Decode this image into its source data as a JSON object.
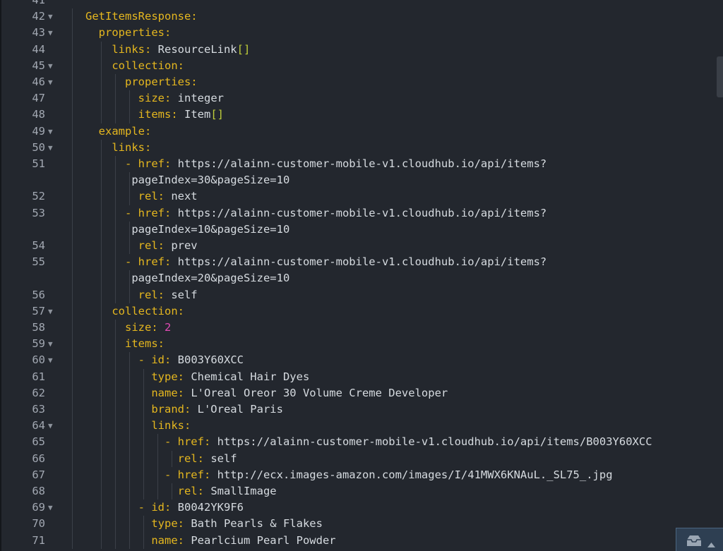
{
  "editor": {
    "colors": {
      "background": "#23272e",
      "key": "#e5b71f",
      "punct": "#c0ce3a",
      "number": "#e14bb4",
      "text": "#d6dbe0"
    },
    "lines": [
      {
        "num": "41",
        "fold": false,
        "segs": []
      },
      {
        "num": "42",
        "fold": true,
        "segs": [
          {
            "t": "GetItemsResponse:",
            "c": "k"
          }
        ]
      },
      {
        "num": "43",
        "fold": true,
        "segs": [
          {
            "t": "  properties:",
            "c": "k"
          }
        ]
      },
      {
        "num": "44",
        "fold": false,
        "segs": [
          {
            "t": "    links:",
            "c": "k"
          },
          {
            "t": " ResourceLink",
            "c": "v"
          },
          {
            "t": "[]",
            "c": "p"
          }
        ]
      },
      {
        "num": "45",
        "fold": true,
        "segs": [
          {
            "t": "    collection:",
            "c": "k"
          }
        ]
      },
      {
        "num": "46",
        "fold": true,
        "segs": [
          {
            "t": "      properties:",
            "c": "k"
          }
        ]
      },
      {
        "num": "47",
        "fold": false,
        "segs": [
          {
            "t": "        size:",
            "c": "k"
          },
          {
            "t": " integer",
            "c": "v"
          }
        ]
      },
      {
        "num": "48",
        "fold": false,
        "segs": [
          {
            "t": "        items:",
            "c": "k"
          },
          {
            "t": " Item",
            "c": "v"
          },
          {
            "t": "[]",
            "c": "p"
          }
        ]
      },
      {
        "num": "49",
        "fold": true,
        "segs": [
          {
            "t": "  example:",
            "c": "k"
          }
        ]
      },
      {
        "num": "50",
        "fold": true,
        "segs": [
          {
            "t": "    links:",
            "c": "k"
          }
        ]
      },
      {
        "num": "51",
        "fold": false,
        "segs": [
          {
            "t": "      - href:",
            "c": "k"
          },
          {
            "t": " https://alainn-customer-mobile-v1.cloudhub.io/api/items?",
            "c": "v"
          }
        ]
      },
      {
        "num": "",
        "fold": false,
        "segs": [
          {
            "t": "       pageIndex=30&pageSize=10",
            "c": "v"
          }
        ]
      },
      {
        "num": "52",
        "fold": false,
        "segs": [
          {
            "t": "        rel:",
            "c": "k"
          },
          {
            "t": " next",
            "c": "v"
          }
        ]
      },
      {
        "num": "53",
        "fold": false,
        "segs": [
          {
            "t": "      - href:",
            "c": "k"
          },
          {
            "t": " https://alainn-customer-mobile-v1.cloudhub.io/api/items?",
            "c": "v"
          }
        ]
      },
      {
        "num": "",
        "fold": false,
        "segs": [
          {
            "t": "       pageIndex=10&pageSize=10",
            "c": "v"
          }
        ]
      },
      {
        "num": "54",
        "fold": false,
        "segs": [
          {
            "t": "        rel:",
            "c": "k"
          },
          {
            "t": " prev",
            "c": "v"
          }
        ]
      },
      {
        "num": "55",
        "fold": false,
        "segs": [
          {
            "t": "      - href:",
            "c": "k"
          },
          {
            "t": " https://alainn-customer-mobile-v1.cloudhub.io/api/items?",
            "c": "v"
          }
        ]
      },
      {
        "num": "",
        "fold": false,
        "segs": [
          {
            "t": "       pageIndex=20&pageSize=10",
            "c": "v"
          }
        ]
      },
      {
        "num": "56",
        "fold": false,
        "segs": [
          {
            "t": "        rel:",
            "c": "k"
          },
          {
            "t": " self",
            "c": "v"
          }
        ]
      },
      {
        "num": "57",
        "fold": true,
        "segs": [
          {
            "t": "    collection:",
            "c": "k"
          }
        ]
      },
      {
        "num": "58",
        "fold": false,
        "segs": [
          {
            "t": "      size:",
            "c": "k"
          },
          {
            "t": " ",
            "c": "v"
          },
          {
            "t": "2",
            "c": "n"
          }
        ]
      },
      {
        "num": "59",
        "fold": true,
        "segs": [
          {
            "t": "      items:",
            "c": "k"
          }
        ]
      },
      {
        "num": "60",
        "fold": true,
        "segs": [
          {
            "t": "        - id:",
            "c": "k"
          },
          {
            "t": " B003Y60XCC",
            "c": "v"
          }
        ]
      },
      {
        "num": "61",
        "fold": false,
        "segs": [
          {
            "t": "          type:",
            "c": "k"
          },
          {
            "t": " Chemical Hair Dyes",
            "c": "v"
          }
        ]
      },
      {
        "num": "62",
        "fold": false,
        "segs": [
          {
            "t": "          name:",
            "c": "k"
          },
          {
            "t": " L'Oreal Oreor 30 Volume Creme Developer",
            "c": "v"
          }
        ]
      },
      {
        "num": "63",
        "fold": false,
        "segs": [
          {
            "t": "          brand:",
            "c": "k"
          },
          {
            "t": " L'Oreal Paris",
            "c": "v"
          }
        ]
      },
      {
        "num": "64",
        "fold": true,
        "segs": [
          {
            "t": "          links:",
            "c": "k"
          }
        ]
      },
      {
        "num": "65",
        "fold": false,
        "segs": [
          {
            "t": "            - href:",
            "c": "k"
          },
          {
            "t": " https://alainn-customer-mobile-v1.cloudhub.io/api/items/B003Y60XCC",
            "c": "v"
          }
        ]
      },
      {
        "num": "66",
        "fold": false,
        "segs": [
          {
            "t": "              rel:",
            "c": "k"
          },
          {
            "t": " self",
            "c": "v"
          }
        ]
      },
      {
        "num": "67",
        "fold": false,
        "segs": [
          {
            "t": "            - href:",
            "c": "k"
          },
          {
            "t": " http://ecx.images-amazon.com/images/I/41MWX6KNAuL._SL75_.jpg",
            "c": "v"
          }
        ]
      },
      {
        "num": "68",
        "fold": false,
        "segs": [
          {
            "t": "              rel:",
            "c": "k"
          },
          {
            "t": " SmallImage",
            "c": "v"
          }
        ]
      },
      {
        "num": "69",
        "fold": true,
        "segs": [
          {
            "t": "        - id:",
            "c": "k"
          },
          {
            "t": " B0042YK9F6",
            "c": "v"
          }
        ]
      },
      {
        "num": "70",
        "fold": false,
        "segs": [
          {
            "t": "          type:",
            "c": "k"
          },
          {
            "t": " Bath Pearls & Flakes",
            "c": "v"
          }
        ]
      },
      {
        "num": "71",
        "fold": false,
        "segs": [
          {
            "t": "          name:",
            "c": "k"
          },
          {
            "t": " Pearlcium Pearl Powder",
            "c": "v"
          }
        ]
      }
    ]
  },
  "icons": {
    "fold": "fold-arrow-icon",
    "panel": "inbox-tray-icon",
    "caret": "caret-up-icon"
  }
}
